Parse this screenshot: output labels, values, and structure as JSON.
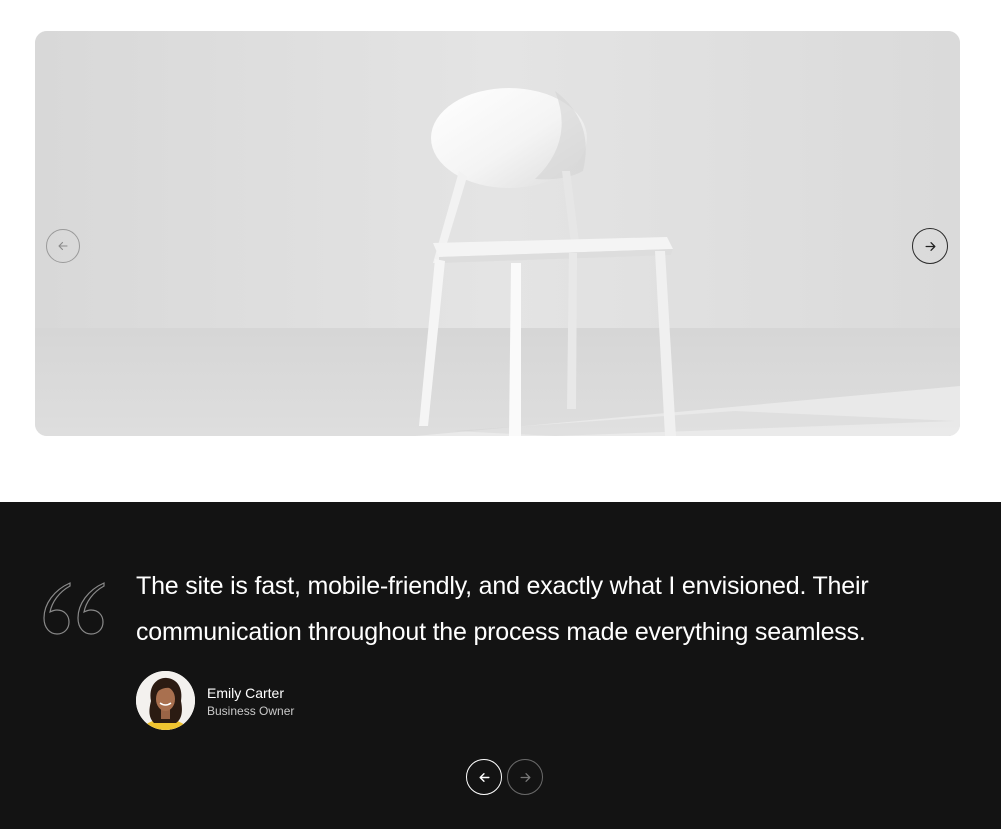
{
  "hero": {
    "image": "white-plastic-chair-photo",
    "prev_icon": "arrow-left-icon",
    "next_icon": "arrow-right-icon"
  },
  "testimonial": {
    "quote_icon": "quote-icon",
    "quote": "The site is fast, mobile-friendly, and exactly what I envisioned. Their communication throughout the process made everything seamless.",
    "author": {
      "name": "Emily Carter",
      "role": "Business Owner"
    },
    "prev_icon": "arrow-left-icon",
    "next_icon": "arrow-right-icon"
  },
  "colors": {
    "dark_background": "#131313",
    "text_light": "#ffffff",
    "hero_background": "#e0e0e0",
    "avatar_shirt": "#f0c430"
  }
}
